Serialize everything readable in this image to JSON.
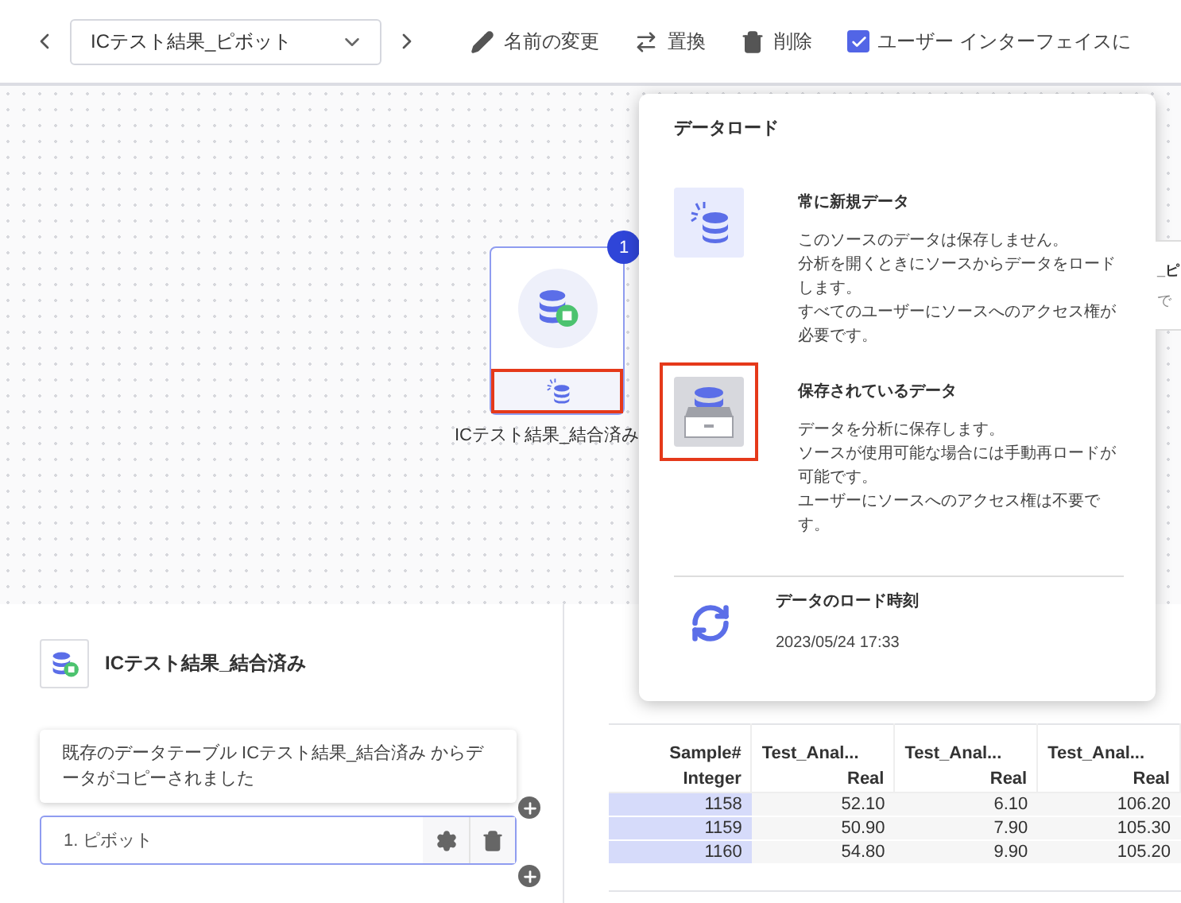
{
  "toolbar": {
    "dropdown": {
      "value": "ICテスト結果_ピボット"
    },
    "actions": [
      {
        "kind": "rename",
        "label": "名前の変更"
      },
      {
        "kind": "replace",
        "label": "置換"
      },
      {
        "kind": "delete",
        "label": "削除"
      }
    ],
    "checkbox": {
      "label": "ユーザー インターフェイスに",
      "checked": true
    }
  },
  "canvas": {
    "node": {
      "label": "ICテスト結果_結合済み",
      "badge": "1",
      "highlighted": true
    },
    "partial_node": {
      "title": "_ピ",
      "subtitle": "で"
    }
  },
  "popover": {
    "title": "データロード",
    "options": [
      {
        "kind": "fresh",
        "title": "常に新規データ",
        "lines": [
          "このソースのデータは保存しません。",
          "分析を開くときにソースからデータをロードします。",
          "すべてのユーザーにソースへのアクセス権が必要です。"
        ],
        "highlighted": false
      },
      {
        "kind": "stored",
        "title": "保存されているデータ",
        "lines": [
          "データを分析に保存します。",
          "ソースが使用可能な場合には手動再ロードが可能です。",
          "ユーザーにソースへのアクセス権は不要です。"
        ],
        "highlighted": true
      }
    ],
    "load_time": {
      "label": "データのロード時刻",
      "value": "2023/05/24 17:33"
    }
  },
  "source": {
    "name": "ICテスト結果_結合済み"
  },
  "message": "既存のデータテーブル ICテスト結果_結合済み からデータがコピーされました",
  "step": {
    "label": "1. ピボット"
  },
  "table": {
    "columns": [
      {
        "name": "Sample#",
        "type": "Integer"
      },
      {
        "name": "Test_Anal...",
        "type": "Real"
      },
      {
        "name": "Test_Anal...",
        "type": "Real"
      },
      {
        "name": "Test_Anal...",
        "type": "Real"
      }
    ],
    "rows": [
      [
        "1158",
        "52.10",
        "6.10",
        "106.20"
      ],
      [
        "1159",
        "50.90",
        "7.90",
        "105.30"
      ],
      [
        "1160",
        "54.80",
        "9.90",
        "105.20"
      ]
    ]
  }
}
